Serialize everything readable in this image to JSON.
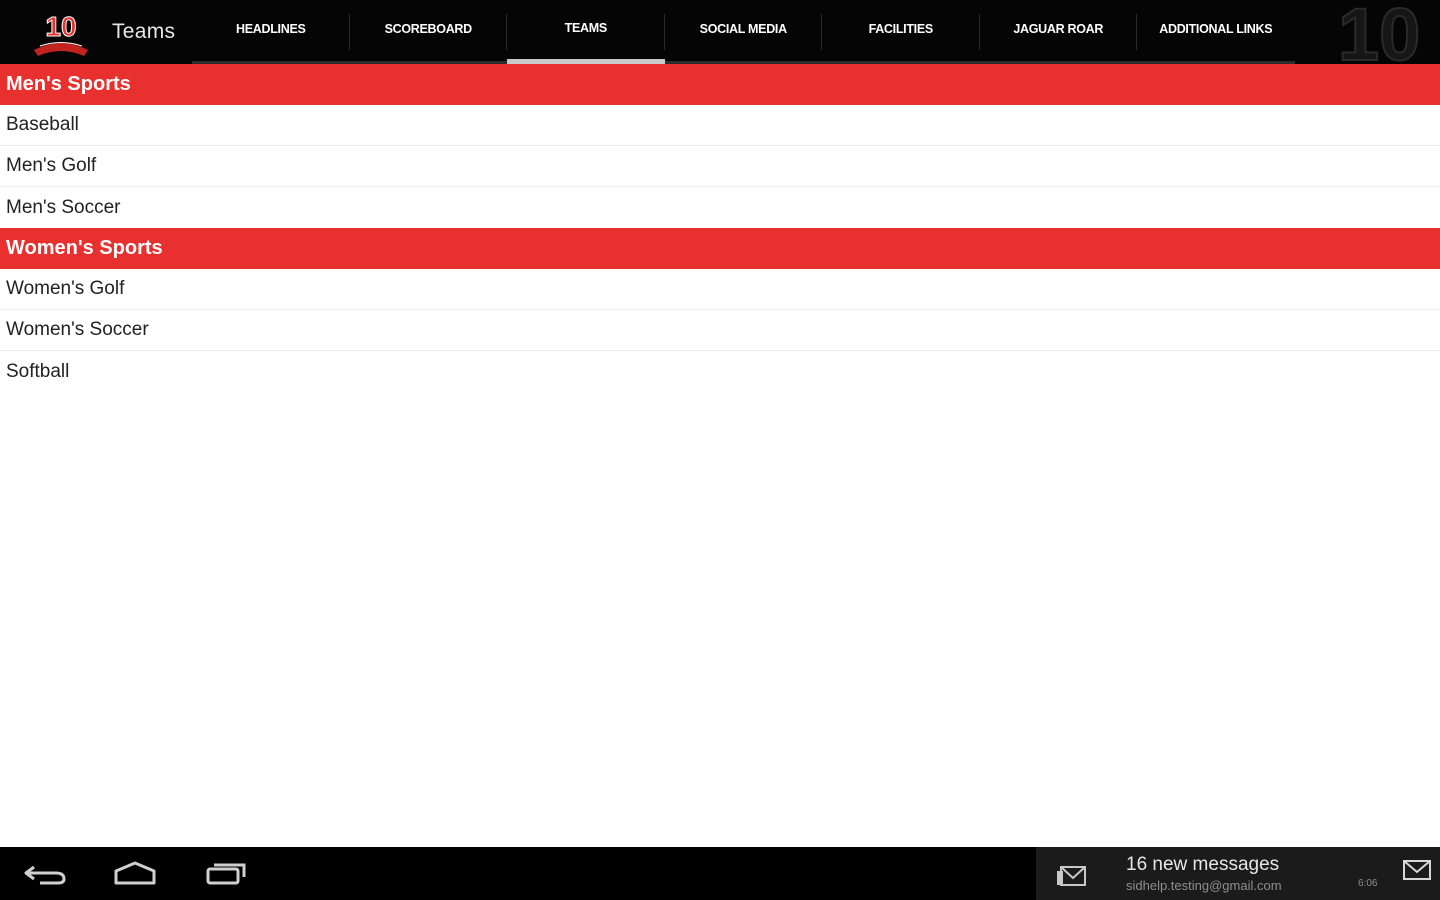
{
  "action_bar": {
    "logo_text": "10",
    "title": "Teams",
    "tabs": [
      {
        "label": "Headlines",
        "selected": false
      },
      {
        "label": "Scoreboard",
        "selected": false
      },
      {
        "label": "Teams",
        "selected": true
      },
      {
        "label": "Social Media",
        "selected": false
      },
      {
        "label": "Facilities",
        "selected": false
      },
      {
        "label": "Jaguar Roar",
        "selected": false
      },
      {
        "label": "Additional Links",
        "selected": false
      }
    ],
    "watermark_text": "10"
  },
  "sections": [
    {
      "header": "Men's Sports",
      "items": [
        "Baseball",
        "Men's Golf",
        "Men's Soccer"
      ]
    },
    {
      "header": "Women's Sports",
      "items": [
        "Women's Golf",
        "Women's Soccer",
        "Softball"
      ]
    }
  ],
  "system_bar": {
    "nav_buttons": [
      "back-icon",
      "home-icon",
      "recent-apps-icon"
    ],
    "notification": {
      "title": "16 new messages",
      "account": "sidhelp.testing@gmail.com",
      "time": "6:06",
      "icon": "gmail-icon"
    }
  },
  "colors": {
    "accent": "#e8312f",
    "topbar_bg": "#050505",
    "notification_bg": "#1b1b1b"
  }
}
